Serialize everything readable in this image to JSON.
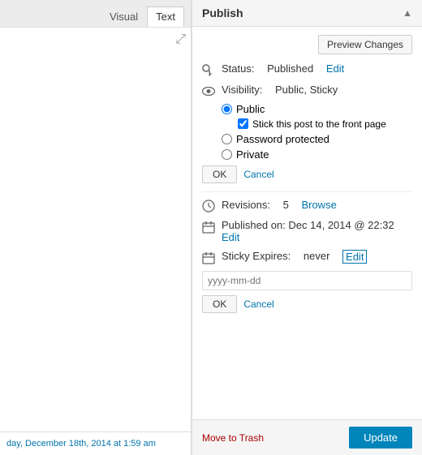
{
  "left_panel": {
    "tab_visual": "Visual",
    "tab_text": "Text",
    "bottom_text": "day, December 18th, 2014 at 1:59 am"
  },
  "right_panel": {
    "title": "Publish",
    "preview_btn": "Preview Changes",
    "status_label": "Status:",
    "status_value": "Published",
    "status_edit": "Edit",
    "visibility_label": "Visibility:",
    "visibility_value": "Public, Sticky",
    "radio_public": "Public",
    "checkbox_sticky": "Stick this post to the front page",
    "radio_password": "Password protected",
    "radio_private": "Private",
    "ok_btn": "OK",
    "cancel_link": "Cancel",
    "revisions_label": "Revisions:",
    "revisions_count": "5",
    "revisions_browse": "Browse",
    "published_label": "Published on:",
    "published_date": "Dec 14, 2014 @ 22:32",
    "published_edit": "Edit",
    "sticky_expires_label": "Sticky Expires:",
    "sticky_expires_value": "never",
    "sticky_expires_edit": "Edit",
    "date_placeholder": "yyyy-mm-dd",
    "ok_btn2": "OK",
    "cancel_link2": "Cancel",
    "trash_link": "Move to Trash",
    "update_btn": "Update"
  }
}
